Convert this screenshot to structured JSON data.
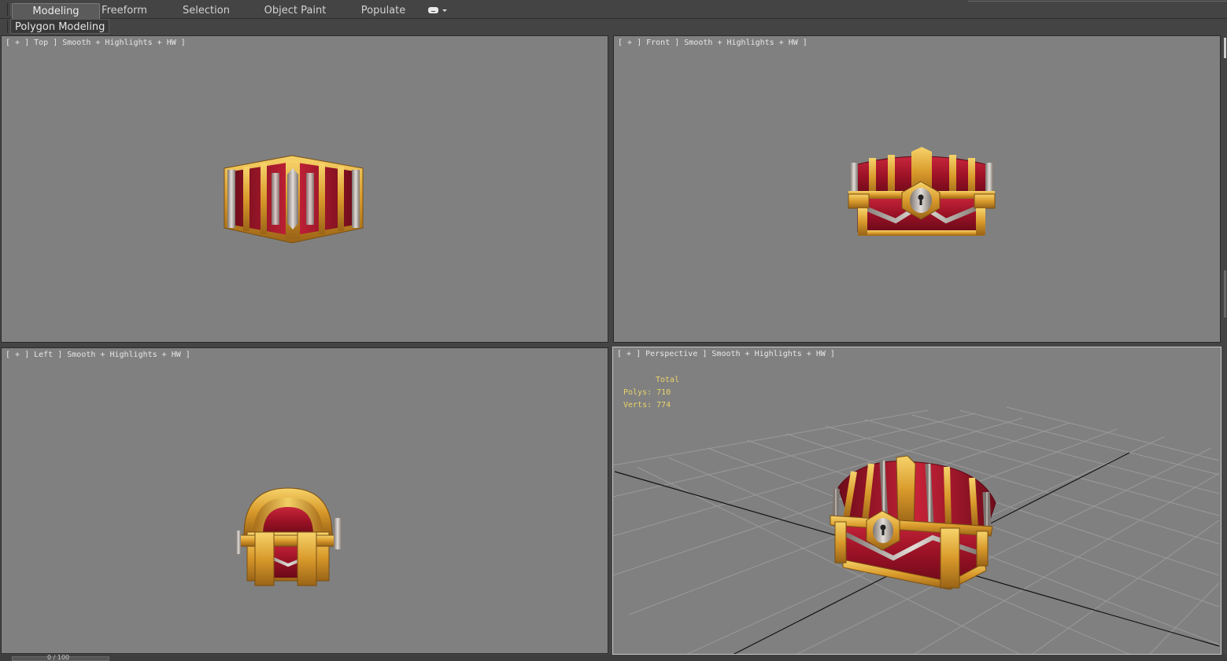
{
  "ribbon": {
    "tabs": [
      {
        "label": "Modeling",
        "active": true
      },
      {
        "label": "Freeform",
        "active": false
      },
      {
        "label": "Selection",
        "active": false
      },
      {
        "label": "Object Paint",
        "active": false
      },
      {
        "label": "Populate",
        "active": false
      }
    ],
    "panel_label": "Polygon Modeling"
  },
  "viewports": {
    "top": {
      "label": "[ + ] Top ] Smooth + Highlights + HW ]"
    },
    "front": {
      "label": "[ + ] Front ] Smooth + Highlights + HW ]"
    },
    "left": {
      "label": "[ + ] Left ] Smooth + Highlights + HW ]"
    },
    "perspective": {
      "label": "[ + ] Perspective ] Smooth + Highlights + HW ]",
      "stats": {
        "heading": "Total",
        "polys": "Polys: 710",
        "verts": "Verts: 774"
      }
    }
  },
  "timeline": {
    "frame": "0 / 100"
  },
  "colors": {
    "viewport_bg": "#808080",
    "ui_bg": "#444444",
    "stats_text": "#e8d36a",
    "chest_red": "#a8162a",
    "chest_gold": "#e0a83a",
    "chest_silver": "#b8b0a8"
  }
}
